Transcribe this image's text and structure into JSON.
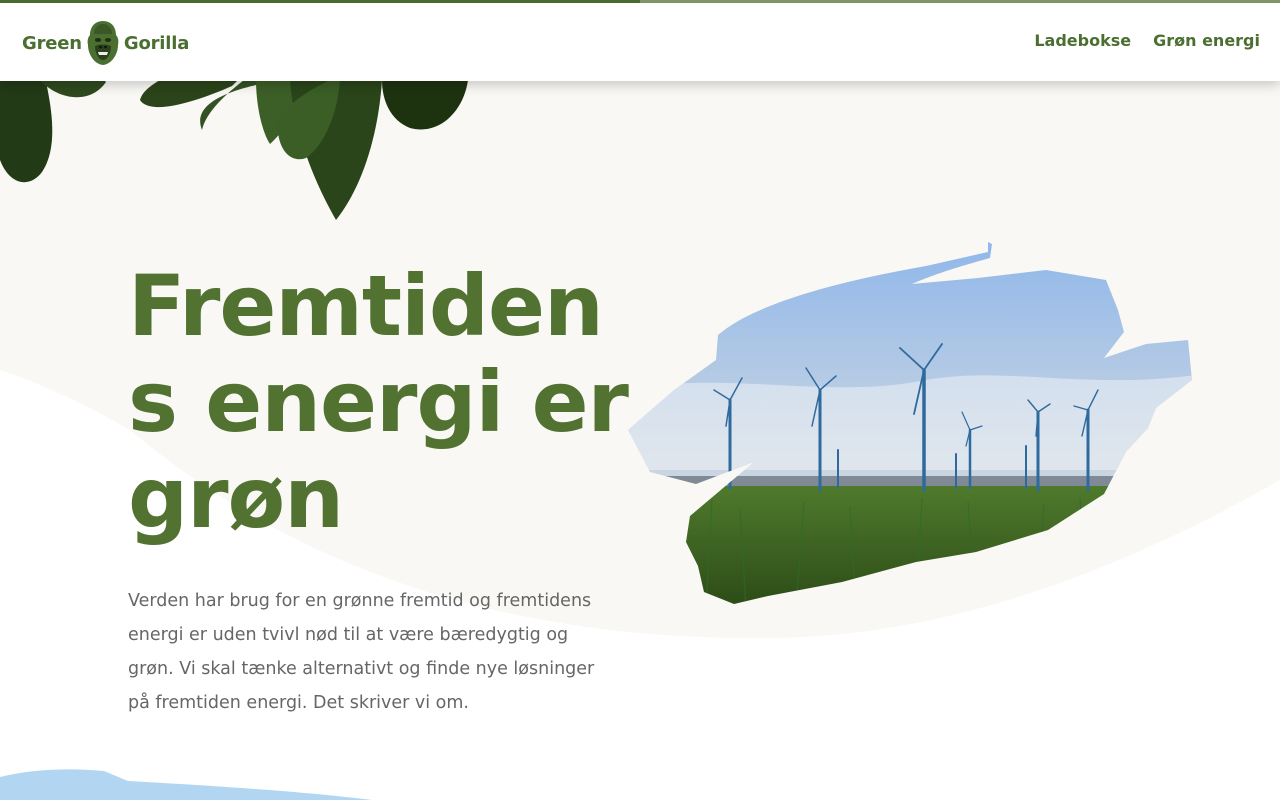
{
  "brand": {
    "name_left": "Green",
    "name_right": "Gorilla",
    "logo_icon": "gorilla-head-icon",
    "color_primary": "#527232",
    "color_dark": "#2d4a1c"
  },
  "progress": {
    "value_percent": 50
  },
  "nav": {
    "items": [
      {
        "label": "Ladebokse"
      },
      {
        "label": "Grøn energi"
      }
    ]
  },
  "hero": {
    "title": "Fremtidens energi er grøn",
    "body": "Verden har brug for en grønne fremtid og fremtidens energi er uden tvivl nød til at være bæredygtig og grøn. Vi skal tænke alternativt og finde nye løsninger på fremtiden energi. Det skriver vi om.",
    "image_icon": "wind-turbines-field-image",
    "decoration_icon": "jungle-leaves-icon"
  }
}
